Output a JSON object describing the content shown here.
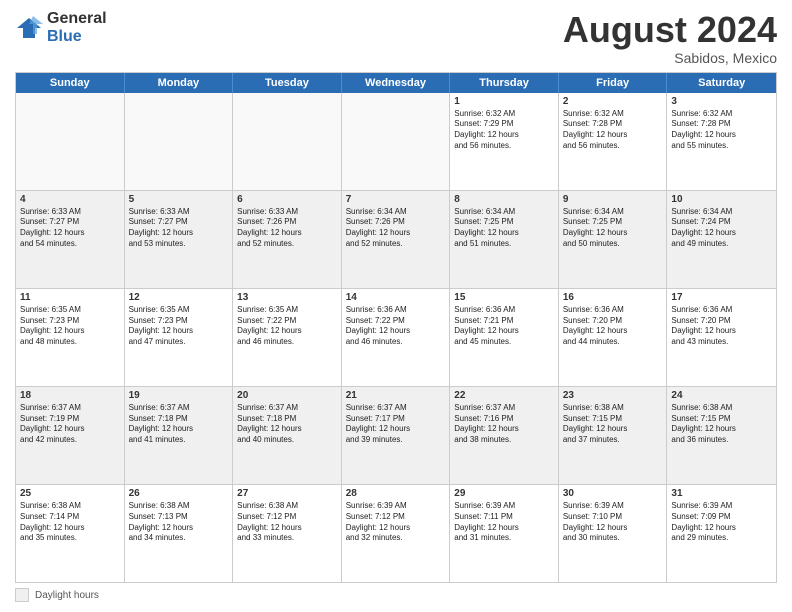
{
  "logo": {
    "general": "General",
    "blue": "Blue"
  },
  "title": {
    "month_year": "August 2024",
    "location": "Sabidos, Mexico"
  },
  "days_of_week": [
    "Sunday",
    "Monday",
    "Tuesday",
    "Wednesday",
    "Thursday",
    "Friday",
    "Saturday"
  ],
  "footer": {
    "label": "Daylight hours"
  },
  "weeks": [
    {
      "cells": [
        {
          "day": "",
          "text": "",
          "empty": true
        },
        {
          "day": "",
          "text": "",
          "empty": true
        },
        {
          "day": "",
          "text": "",
          "empty": true
        },
        {
          "day": "",
          "text": "",
          "empty": true
        },
        {
          "day": "1",
          "text": "Sunrise: 6:32 AM\nSunset: 7:29 PM\nDaylight: 12 hours\nand 56 minutes.",
          "empty": false
        },
        {
          "day": "2",
          "text": "Sunrise: 6:32 AM\nSunset: 7:28 PM\nDaylight: 12 hours\nand 56 minutes.",
          "empty": false
        },
        {
          "day": "3",
          "text": "Sunrise: 6:32 AM\nSunset: 7:28 PM\nDaylight: 12 hours\nand 55 minutes.",
          "empty": false
        }
      ]
    },
    {
      "cells": [
        {
          "day": "4",
          "text": "Sunrise: 6:33 AM\nSunset: 7:27 PM\nDaylight: 12 hours\nand 54 minutes.",
          "empty": false
        },
        {
          "day": "5",
          "text": "Sunrise: 6:33 AM\nSunset: 7:27 PM\nDaylight: 12 hours\nand 53 minutes.",
          "empty": false
        },
        {
          "day": "6",
          "text": "Sunrise: 6:33 AM\nSunset: 7:26 PM\nDaylight: 12 hours\nand 52 minutes.",
          "empty": false
        },
        {
          "day": "7",
          "text": "Sunrise: 6:34 AM\nSunset: 7:26 PM\nDaylight: 12 hours\nand 52 minutes.",
          "empty": false
        },
        {
          "day": "8",
          "text": "Sunrise: 6:34 AM\nSunset: 7:25 PM\nDaylight: 12 hours\nand 51 minutes.",
          "empty": false
        },
        {
          "day": "9",
          "text": "Sunrise: 6:34 AM\nSunset: 7:25 PM\nDaylight: 12 hours\nand 50 minutes.",
          "empty": false
        },
        {
          "day": "10",
          "text": "Sunrise: 6:34 AM\nSunset: 7:24 PM\nDaylight: 12 hours\nand 49 minutes.",
          "empty": false
        }
      ]
    },
    {
      "cells": [
        {
          "day": "11",
          "text": "Sunrise: 6:35 AM\nSunset: 7:23 PM\nDaylight: 12 hours\nand 48 minutes.",
          "empty": false
        },
        {
          "day": "12",
          "text": "Sunrise: 6:35 AM\nSunset: 7:23 PM\nDaylight: 12 hours\nand 47 minutes.",
          "empty": false
        },
        {
          "day": "13",
          "text": "Sunrise: 6:35 AM\nSunset: 7:22 PM\nDaylight: 12 hours\nand 46 minutes.",
          "empty": false
        },
        {
          "day": "14",
          "text": "Sunrise: 6:36 AM\nSunset: 7:22 PM\nDaylight: 12 hours\nand 46 minutes.",
          "empty": false
        },
        {
          "day": "15",
          "text": "Sunrise: 6:36 AM\nSunset: 7:21 PM\nDaylight: 12 hours\nand 45 minutes.",
          "empty": false
        },
        {
          "day": "16",
          "text": "Sunrise: 6:36 AM\nSunset: 7:20 PM\nDaylight: 12 hours\nand 44 minutes.",
          "empty": false
        },
        {
          "day": "17",
          "text": "Sunrise: 6:36 AM\nSunset: 7:20 PM\nDaylight: 12 hours\nand 43 minutes.",
          "empty": false
        }
      ]
    },
    {
      "cells": [
        {
          "day": "18",
          "text": "Sunrise: 6:37 AM\nSunset: 7:19 PM\nDaylight: 12 hours\nand 42 minutes.",
          "empty": false
        },
        {
          "day": "19",
          "text": "Sunrise: 6:37 AM\nSunset: 7:18 PM\nDaylight: 12 hours\nand 41 minutes.",
          "empty": false
        },
        {
          "day": "20",
          "text": "Sunrise: 6:37 AM\nSunset: 7:18 PM\nDaylight: 12 hours\nand 40 minutes.",
          "empty": false
        },
        {
          "day": "21",
          "text": "Sunrise: 6:37 AM\nSunset: 7:17 PM\nDaylight: 12 hours\nand 39 minutes.",
          "empty": false
        },
        {
          "day": "22",
          "text": "Sunrise: 6:37 AM\nSunset: 7:16 PM\nDaylight: 12 hours\nand 38 minutes.",
          "empty": false
        },
        {
          "day": "23",
          "text": "Sunrise: 6:38 AM\nSunset: 7:15 PM\nDaylight: 12 hours\nand 37 minutes.",
          "empty": false
        },
        {
          "day": "24",
          "text": "Sunrise: 6:38 AM\nSunset: 7:15 PM\nDaylight: 12 hours\nand 36 minutes.",
          "empty": false
        }
      ]
    },
    {
      "cells": [
        {
          "day": "25",
          "text": "Sunrise: 6:38 AM\nSunset: 7:14 PM\nDaylight: 12 hours\nand 35 minutes.",
          "empty": false
        },
        {
          "day": "26",
          "text": "Sunrise: 6:38 AM\nSunset: 7:13 PM\nDaylight: 12 hours\nand 34 minutes.",
          "empty": false
        },
        {
          "day": "27",
          "text": "Sunrise: 6:38 AM\nSunset: 7:12 PM\nDaylight: 12 hours\nand 33 minutes.",
          "empty": false
        },
        {
          "day": "28",
          "text": "Sunrise: 6:39 AM\nSunset: 7:12 PM\nDaylight: 12 hours\nand 32 minutes.",
          "empty": false
        },
        {
          "day": "29",
          "text": "Sunrise: 6:39 AM\nSunset: 7:11 PM\nDaylight: 12 hours\nand 31 minutes.",
          "empty": false
        },
        {
          "day": "30",
          "text": "Sunrise: 6:39 AM\nSunset: 7:10 PM\nDaylight: 12 hours\nand 30 minutes.",
          "empty": false
        },
        {
          "day": "31",
          "text": "Sunrise: 6:39 AM\nSunset: 7:09 PM\nDaylight: 12 hours\nand 29 minutes.",
          "empty": false
        }
      ]
    }
  ]
}
